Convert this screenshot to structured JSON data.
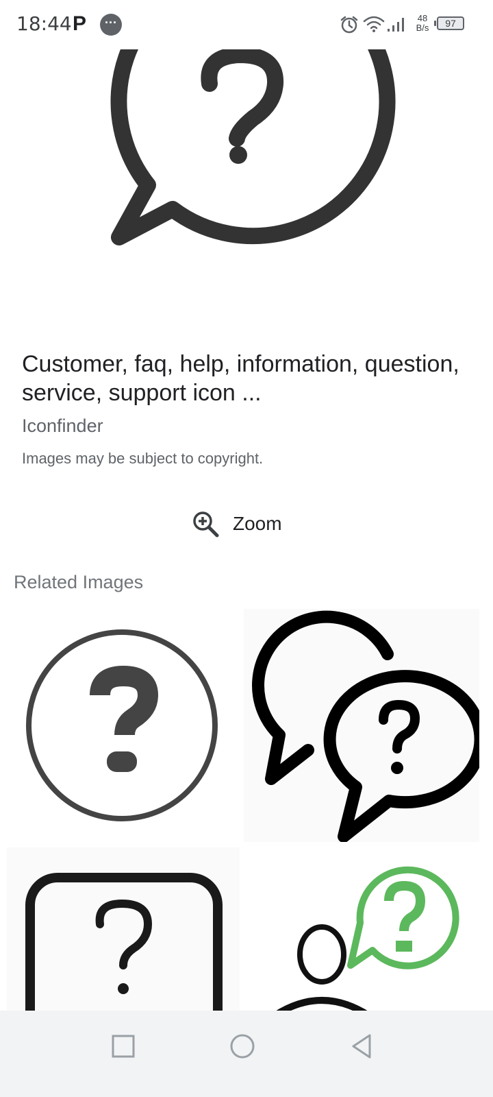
{
  "status_bar": {
    "time": "18:44",
    "notification_letter": "P",
    "message_dots": "···",
    "net_speed_value": "48",
    "net_speed_unit": "B/s",
    "battery": "97"
  },
  "result": {
    "title": "Customer, faq, help, information, question, service, support icon ...",
    "source": "Iconfinder",
    "copyright": "Images may be subject to copyright."
  },
  "zoom": {
    "label": "Zoom",
    "icon": "zoom-in-icon"
  },
  "related": {
    "title": "Related Images",
    "items": [
      {
        "icon": "question-circle-icon"
      },
      {
        "icon": "question-chat-bubbles-icon"
      },
      {
        "icon": "question-rounded-square-icon"
      },
      {
        "icon": "user-question-bubble-icon",
        "accent": "#5cb85c"
      }
    ]
  },
  "colors": {
    "icon_dark": "#333333",
    "accent_green": "#5cb85c",
    "nav_bg": "#f1f3f4"
  },
  "nav": {
    "recent": "square-icon",
    "home": "circle-icon",
    "back": "triangle-back-icon"
  }
}
